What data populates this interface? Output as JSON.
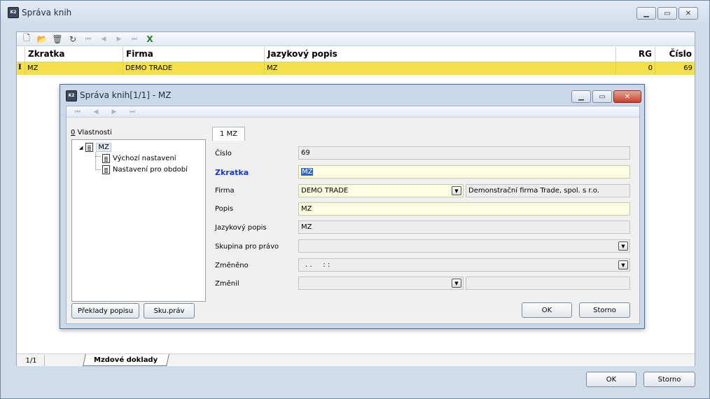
{
  "window": {
    "title": "Správa knih",
    "icon": "app-icon",
    "controls": [
      "minimize-icon",
      "maximize-icon",
      "close-icon"
    ]
  },
  "toolbar": {
    "icons": [
      "new-document-icon",
      "open-folder-icon",
      "delete-icon",
      "refresh-icon",
      "first-record-icon",
      "previous-record-icon",
      "next-record-icon",
      "last-record-icon",
      "excel-export-icon"
    ]
  },
  "grid": {
    "columns": [
      "Zkratka",
      "Firma",
      "Jazykový popis",
      "RG",
      "Číslo"
    ],
    "rows": [
      {
        "indicator": "I",
        "zkratka": "MZ",
        "firma": "DEMO TRADE",
        "jazykovy_popis": "MZ",
        "rg": "0",
        "cislo": "69"
      }
    ]
  },
  "dialog": {
    "title": "Správa knih[1/1] - MZ",
    "props_label": "Vlastnosti",
    "props_label_accel": "0",
    "tree": {
      "root": "MZ",
      "children": [
        "Výchozí nastavení",
        "Nastavení pro období"
      ]
    },
    "tab_label": "1 MZ",
    "fields": {
      "cislo": {
        "label": "Číslo",
        "value": "69"
      },
      "zkratka": {
        "label": "Zkratka",
        "value": "MZ"
      },
      "firma": {
        "label": "Firma",
        "value": "DEMO TRADE",
        "description": "Demonstrační firma Trade, spol. s r.o."
      },
      "popis": {
        "label": "Popis",
        "value": "MZ"
      },
      "jazykovy_popis": {
        "label": "Jazykový popis",
        "value": "MZ"
      },
      "skupina_pro_pravo": {
        "label": "Skupina pro právo",
        "value": ""
      },
      "zmeneno": {
        "label": "Změněno",
        "value": ". .     : :"
      },
      "zmenil": {
        "label": "Změnil",
        "value": ""
      }
    },
    "buttons": {
      "preklady": "Překlady popisu",
      "sku_prav": "Sku.práv",
      "ok": "OK",
      "storno": "Storno"
    }
  },
  "status": {
    "pager": "1/1",
    "sheet_tab": "Mzdové doklady"
  },
  "footer_buttons": {
    "ok": "OK",
    "storno": "Storno"
  },
  "colors": {
    "selected_row": "#f4df4c",
    "required_label": "#1935d6",
    "editable_field": "#fdfde1"
  }
}
